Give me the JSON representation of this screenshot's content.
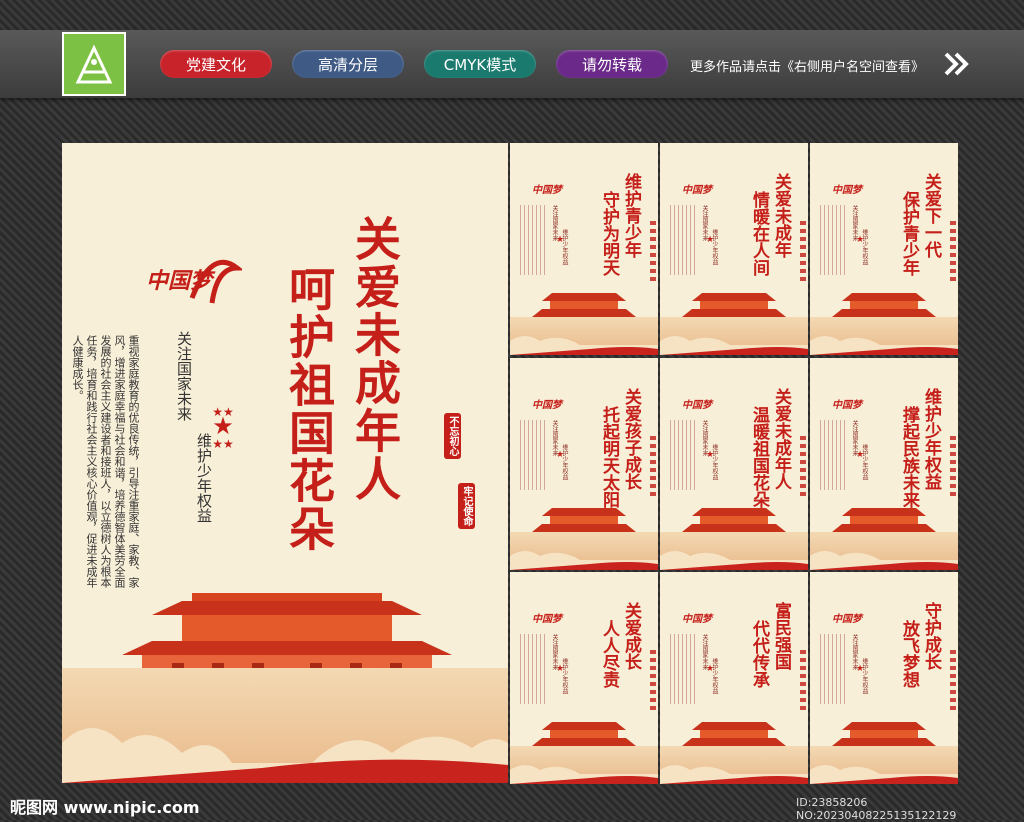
{
  "header": {
    "tags": [
      {
        "label": "党建文化",
        "color": "#c8232a"
      },
      {
        "label": "高清分层",
        "color": "#3e5a85"
      },
      {
        "label": "CMYK模式",
        "color": "#1a7a6e"
      },
      {
        "label": "请勿转载",
        "color": "#6b2a8a"
      }
    ],
    "promo_text": "更多作品请点击《右侧用户名空间查看》"
  },
  "main_poster": {
    "title_col1": "关爱未成年人",
    "title_col2": "呵护祖国花朵",
    "slogan_col1": "关注国家未来",
    "slogan_col2": "维护少年权益",
    "body_text": "重视家庭教育的优良传统，引导注重家庭、家教、家风，增进家庭幸福与社会和谐，培养德智体美劳全面发展的社会主义建设者和接班人，以立德树人为根本任务，培育和践行社会主义核心价值观，促进未成年人健康成长。",
    "dream_logo": "中国梦",
    "stamp1": "不忘初心",
    "stamp2": "牢记使命"
  },
  "small_posters": [
    {
      "col1": "维护青少年",
      "col2": "守护为明天"
    },
    {
      "col1": "关爱未成年",
      "col2": "情暖在人间"
    },
    {
      "col1": "关爱下一代",
      "col2": "保护青少年"
    },
    {
      "col1": "关爱孩子成长",
      "col2": "托起明天太阳"
    },
    {
      "col1": "关爱未成年人",
      "col2": "温暖祖国花朵"
    },
    {
      "col1": "维护少年权益",
      "col2": "撑起民族未来"
    },
    {
      "col1": "关爱成长",
      "col2": "人人尽责"
    },
    {
      "col1": "富民强国",
      "col2": "代代传承"
    },
    {
      "col1": "守护成长",
      "col2": "放飞梦想"
    }
  ],
  "small_slogans": {
    "col1": "关注国家未来",
    "col2": "维护少年权益"
  },
  "footer": {
    "watermark": "昵图网 www.nipic.com",
    "id_text": "ID:23858206 NO:20230408225135122129"
  }
}
